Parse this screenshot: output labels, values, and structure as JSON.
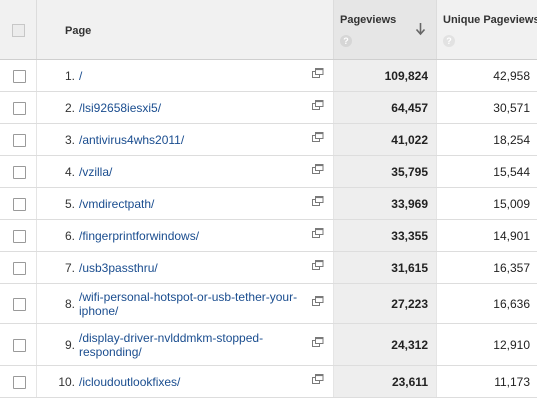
{
  "header": {
    "page_label": "Page",
    "pageviews_label": "Pageviews",
    "unique_pageviews_label": "Unique Pageviews",
    "help_glyph": "?"
  },
  "rows": [
    {
      "rank": "1.",
      "page": "/",
      "pageviews": "109,824",
      "unique_pageviews": "42,958"
    },
    {
      "rank": "2.",
      "page": "/lsi92658iesxi5/",
      "pageviews": "64,457",
      "unique_pageviews": "30,571"
    },
    {
      "rank": "3.",
      "page": "/antivirus4whs2011/",
      "pageviews": "41,022",
      "unique_pageviews": "18,254"
    },
    {
      "rank": "4.",
      "page": "/vzilla/",
      "pageviews": "35,795",
      "unique_pageviews": "15,544"
    },
    {
      "rank": "5.",
      "page": "/vmdirectpath/",
      "pageviews": "33,969",
      "unique_pageviews": "15,009"
    },
    {
      "rank": "6.",
      "page": "/fingerprintforwindows/",
      "pageviews": "33,355",
      "unique_pageviews": "14,901"
    },
    {
      "rank": "7.",
      "page": "/usb3passthru/",
      "pageviews": "31,615",
      "unique_pageviews": "16,357"
    },
    {
      "rank": "8.",
      "page": "/wifi-personal-hotspot-or-usb-tether-your-iphone/",
      "pageviews": "27,223",
      "unique_pageviews": "16,636"
    },
    {
      "rank": "9.",
      "page": "/display-driver-nvlddmkm-stopped-responding/",
      "pageviews": "24,312",
      "unique_pageviews": "12,910"
    },
    {
      "rank": "10.",
      "page": "/icloudoutlookfixes/",
      "pageviews": "23,611",
      "unique_pageviews": "11,173"
    }
  ],
  "colors": {
    "link": "#1a4d8f",
    "header_bg": "#f1f1f1",
    "sorted_col_bg": "#eeeeee"
  },
  "icons": {
    "sort": "arrow-down-icon",
    "popout": "open-in-new-window-icon",
    "help": "help-icon"
  }
}
